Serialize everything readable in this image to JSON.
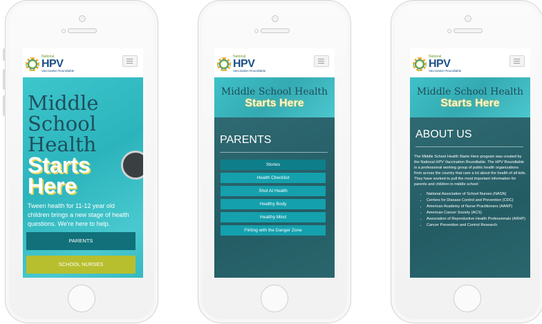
{
  "logo": {
    "small": "National",
    "big": "HPV",
    "sub": "Vaccination Roundtable"
  },
  "banner": {
    "line1": "Middle School Health",
    "line2": "Starts Here"
  },
  "hero": {
    "line1": "Middle",
    "line2": "School",
    "line3": "Health",
    "line4": "Starts",
    "line5": "Here",
    "paragraph": "Tween health for 11-12 year old children brings a new stage of health questions. We're here to help.",
    "button1": "PARENTS",
    "button2": "SCHOOL NURSES"
  },
  "parents": {
    "title": "PARENTS",
    "items": [
      "Stories",
      "Health Checklist",
      "Shot At Health",
      "Healthy Body",
      "Healthy Mind",
      "Flirting with the Danger Zone"
    ]
  },
  "about": {
    "title": "ABOUT US",
    "intro": "The Middle School Health Starts Here program was created by the National HPV Vaccination Roundtable. The HPV Roundtable is a professional working group of public health organizations from across the country that care a lot about the health of all kids. They have worked to pull the most important information for parents and children in middle school:",
    "list": [
      "National Association of School Nurses (NASN)",
      "Centers for Disease Control and Prevention (CDC)",
      "American Academy of Nurse Practitioners (AANP)",
      "American Cancer Society (ACS)",
      "Association of Reproductive Health Professionals (ARHP)",
      "Cancer Prevention and Control Research"
    ]
  },
  "colors": {
    "teal": "#3fc1c9",
    "dark_teal": "#245c64",
    "button_teal": "#15a0ad",
    "parents_btn": "#11707a",
    "nurses_btn": "#b8bf2f"
  }
}
